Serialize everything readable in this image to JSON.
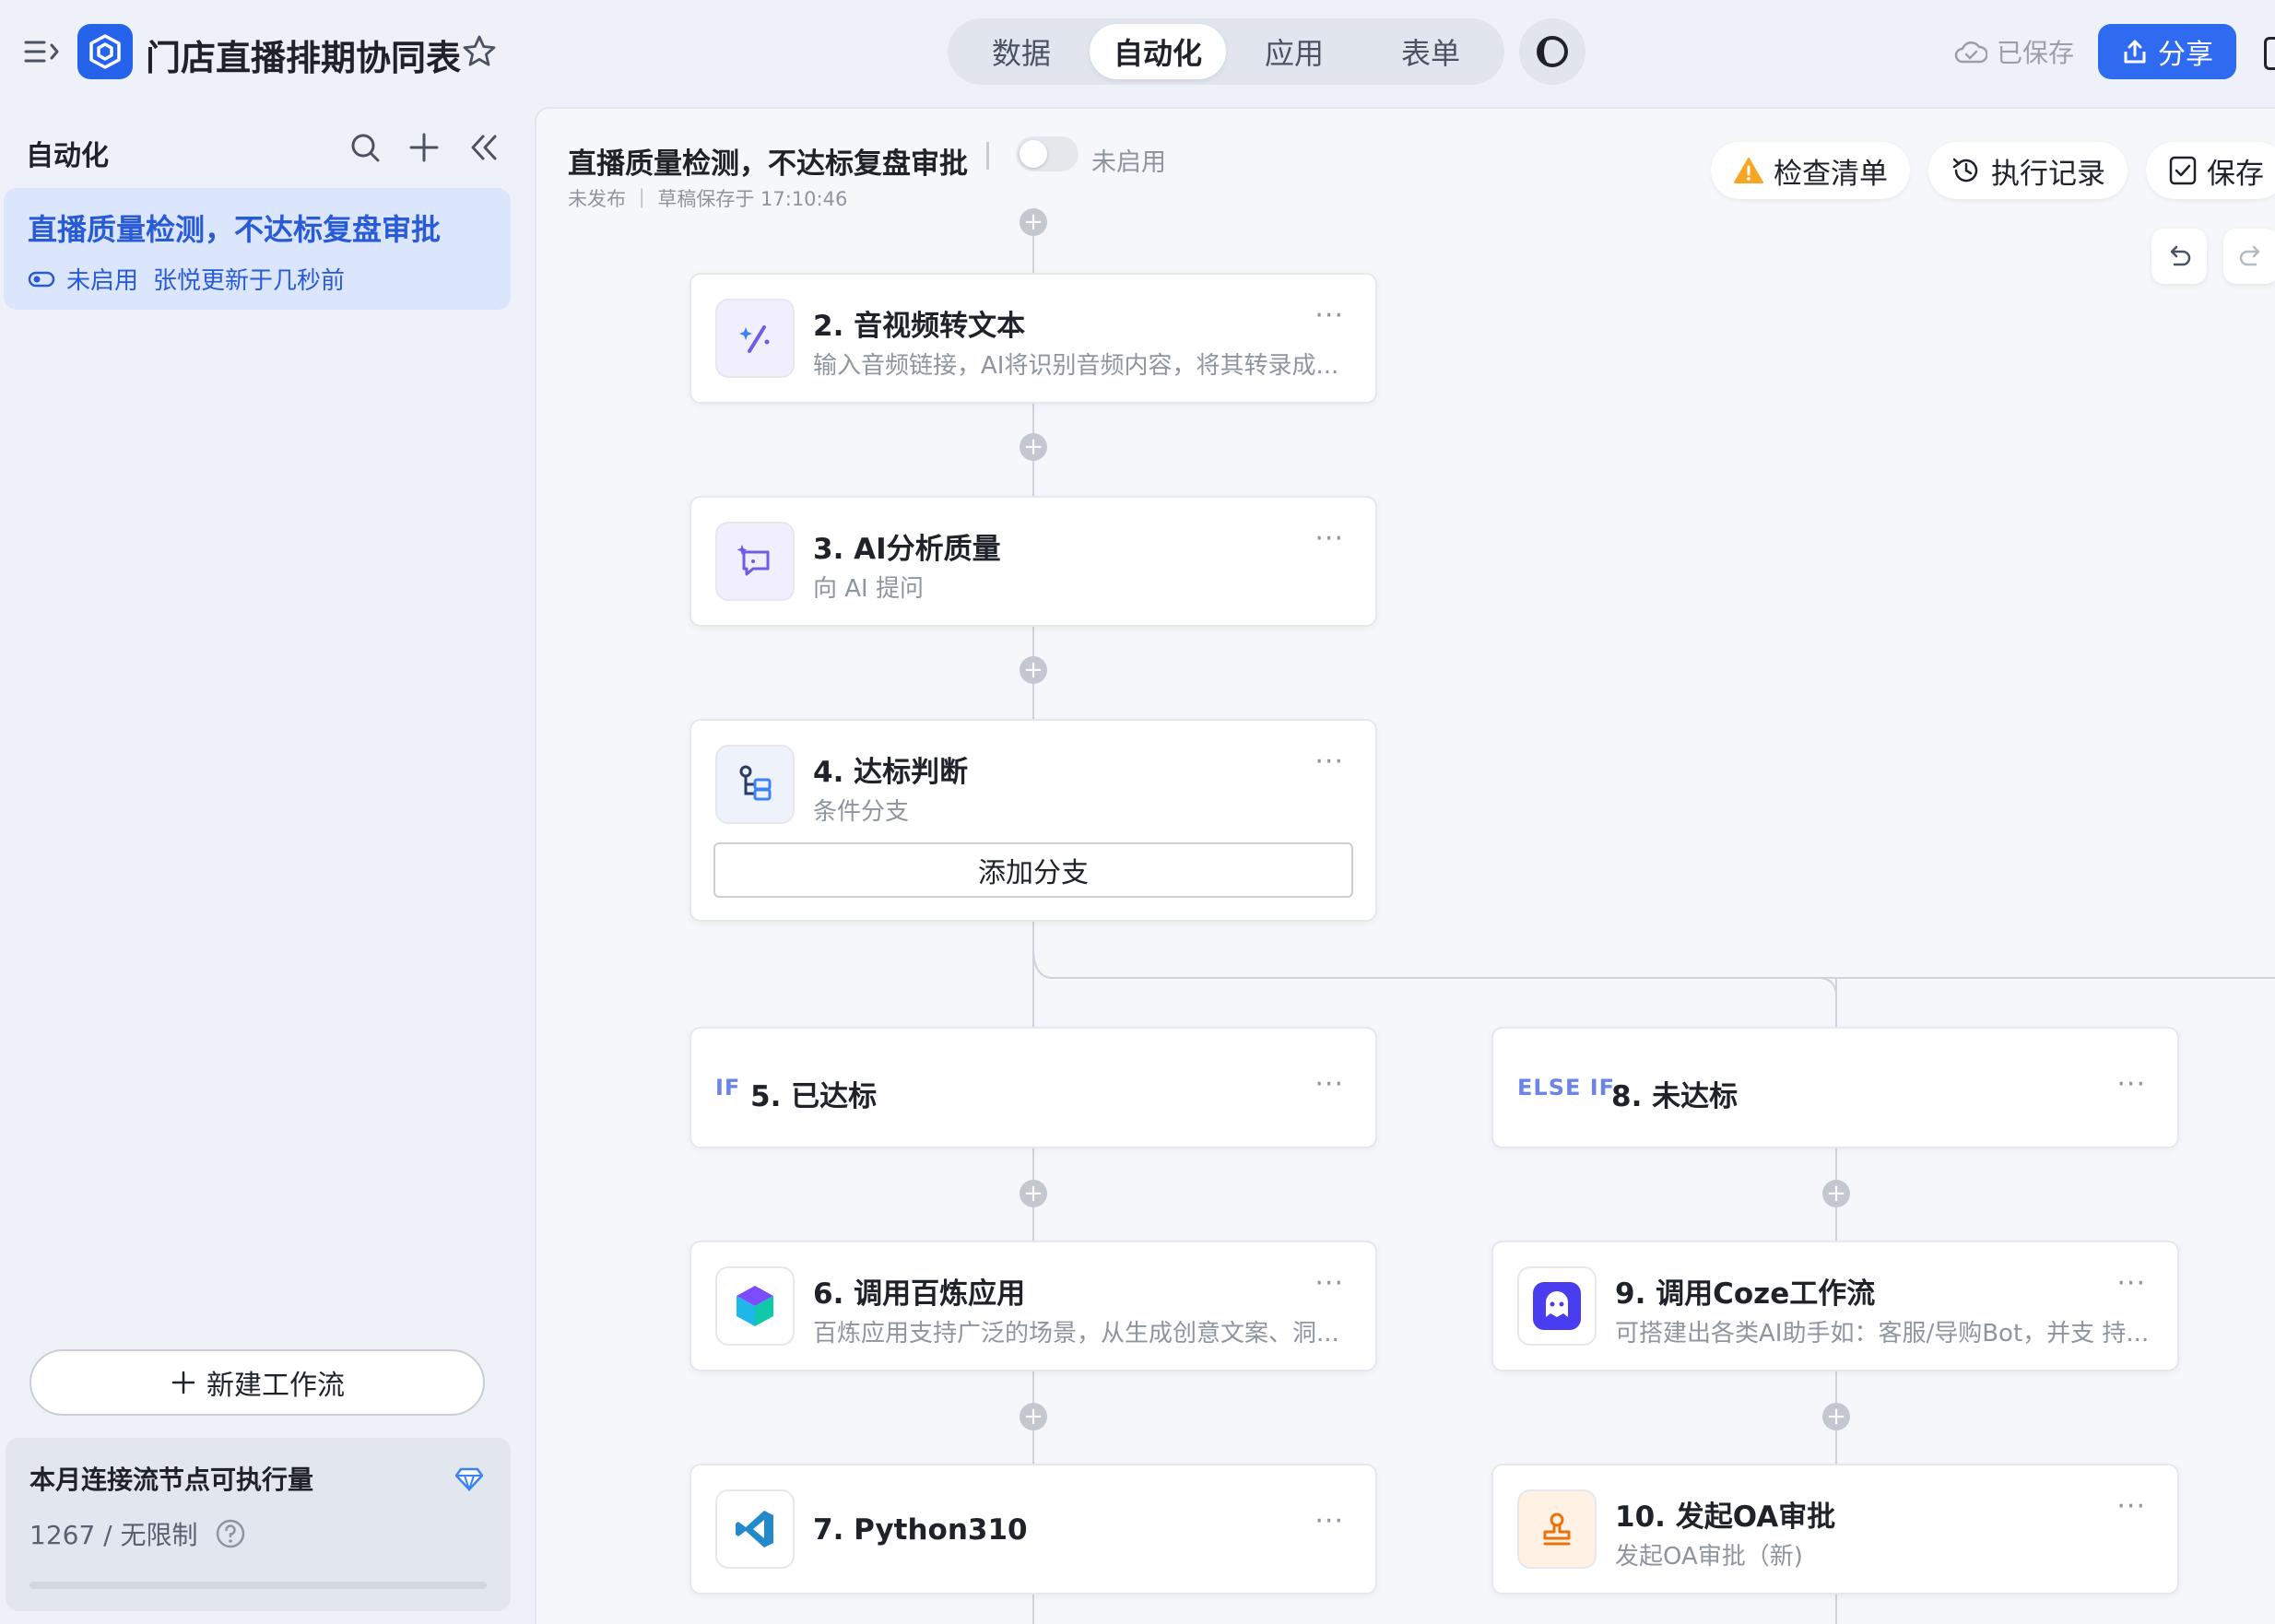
{
  "app": {
    "title": "门店直播排期协同表",
    "mode_tabs": [
      "数据",
      "自动化",
      "应用",
      "表单"
    ],
    "active_tab": "自动化",
    "saved_status": "已保存",
    "share_label": "分享",
    "brand_color": "#2f6bf0"
  },
  "sidebar": {
    "header": "自动化",
    "workflow": {
      "title": "直播质量检测，不达标复盘审批",
      "status": "未启用",
      "updated": "张悦更新于几秒前"
    },
    "new_workflow_label": "新建工作流",
    "quota": {
      "title": "本月连接流节点可执行量",
      "value": "1267 / 无限制"
    }
  },
  "canvas": {
    "title": "直播质量检测，不达标复盘审批",
    "toggle_label": "未启用",
    "sub_status": "未发布 ｜ 草稿保存于 17:10:46",
    "actions": {
      "checklist": "检查清单",
      "history": "执行记录",
      "save": "保存"
    }
  },
  "nodes": [
    {
      "title": "2. 音视频转文本",
      "desc": "输入音频链接，AI将识别音频内容，将其转录成...",
      "icon": "magic-wand-icon"
    },
    {
      "title": "3. AI分析质量",
      "desc": "向 AI 提问",
      "icon": "ai-chat-icon"
    },
    {
      "title": "4. 达标判断",
      "desc": "条件分支",
      "icon": "branch-icon",
      "button": "添加分支"
    },
    {
      "tag": "IF",
      "title": "5. 已达标"
    },
    {
      "tag": "ELSE IF",
      "title": "8. 未达标"
    },
    {
      "title": "6. 调用百炼应用",
      "desc": "百炼应用支持广泛的场景，从生成创意文案、洞...",
      "icon": "bailian-logo-icon"
    },
    {
      "title": "9. 调用Coze工作流",
      "desc": "可搭建出各类AI助手如：客服/导购Bot，并支 持...",
      "icon": "coze-logo-icon"
    },
    {
      "title": "7. Python310",
      "icon": "vscode-logo-icon"
    },
    {
      "title": "10. 发起OA审批",
      "desc": "发起OA审批（新)",
      "icon": "stamp-icon"
    }
  ],
  "node_more_label": "···"
}
